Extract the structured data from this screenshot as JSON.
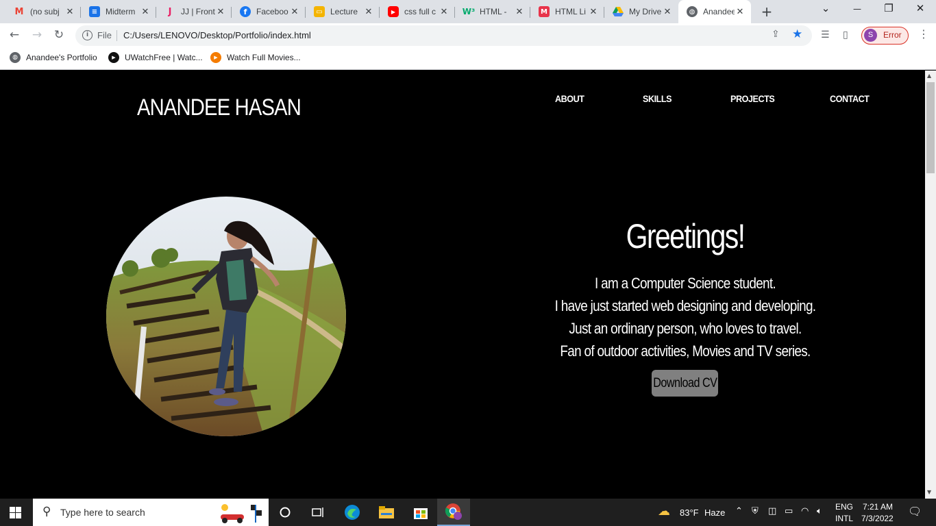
{
  "browser": {
    "tabs": [
      {
        "title": "(no subj",
        "icon": "gmail-icon",
        "color": "#ea4335",
        "glyph": "M"
      },
      {
        "title": "Midterm",
        "icon": "classroom-icon",
        "color": "#1a73e8",
        "glyph": "≡"
      },
      {
        "title": "JJ | Front",
        "icon": "j-icon",
        "color": "#e91e63",
        "glyph": "J"
      },
      {
        "title": "Faceboo",
        "icon": "facebook-icon",
        "color": "#1877f2",
        "glyph": "f"
      },
      {
        "title": "Lecture",
        "icon": "slides-icon",
        "color": "#f4b400",
        "glyph": "▭"
      },
      {
        "title": "css full c",
        "icon": "youtube-icon",
        "color": "#ff0000",
        "glyph": "▶"
      },
      {
        "title": "HTML -",
        "icon": "w3-icon",
        "color": "#04aa6d",
        "glyph": "W"
      },
      {
        "title": "HTML Li",
        "icon": "m-icon",
        "color": "#e8334a",
        "glyph": "M"
      },
      {
        "title": "My Drive",
        "icon": "drive-icon",
        "color": "#fbbc04",
        "glyph": "▲"
      },
      {
        "title": "Anandee",
        "icon": "globe-icon",
        "color": "#5f6368",
        "glyph": "◍",
        "active": true
      }
    ],
    "new_tab": "+",
    "window_controls": {
      "tab_search": "⌄",
      "minimize": "—",
      "restore": "❐",
      "close": "✕"
    },
    "address": {
      "scheme": "File",
      "url": "C:/Users/LENOVO/Desktop/Portfolio/index.html"
    },
    "profile": {
      "initial": "S",
      "status": "Error"
    },
    "bookmarks": [
      {
        "label": "Anandee's Portfolio",
        "icon": "globe-icon"
      },
      {
        "label": "UWatchFree | Watc...",
        "icon": "play-icon"
      },
      {
        "label": "Watch Full Movies...",
        "icon": "movie-icon"
      }
    ]
  },
  "page": {
    "logo": "ANANDEE HASAN",
    "nav": [
      "ABOUT",
      "SKILLS",
      "PROJECTS",
      "CONTACT"
    ],
    "greeting": "Greetings!",
    "bio": [
      "I am a Computer Science student.",
      "I have just started web designing and developing.",
      "Just an ordinary person, who loves to travel.",
      "Fan of outdoor activities, Movies and TV series."
    ],
    "cta": "Download CV"
  },
  "taskbar": {
    "search_placeholder": "Type here to search",
    "weather": {
      "temp": "83°F",
      "condition": "Haze"
    },
    "language": {
      "line1": "ENG",
      "line2": "INTL"
    },
    "clock": {
      "time": "7:21 AM",
      "date": "7/3/2022"
    }
  }
}
